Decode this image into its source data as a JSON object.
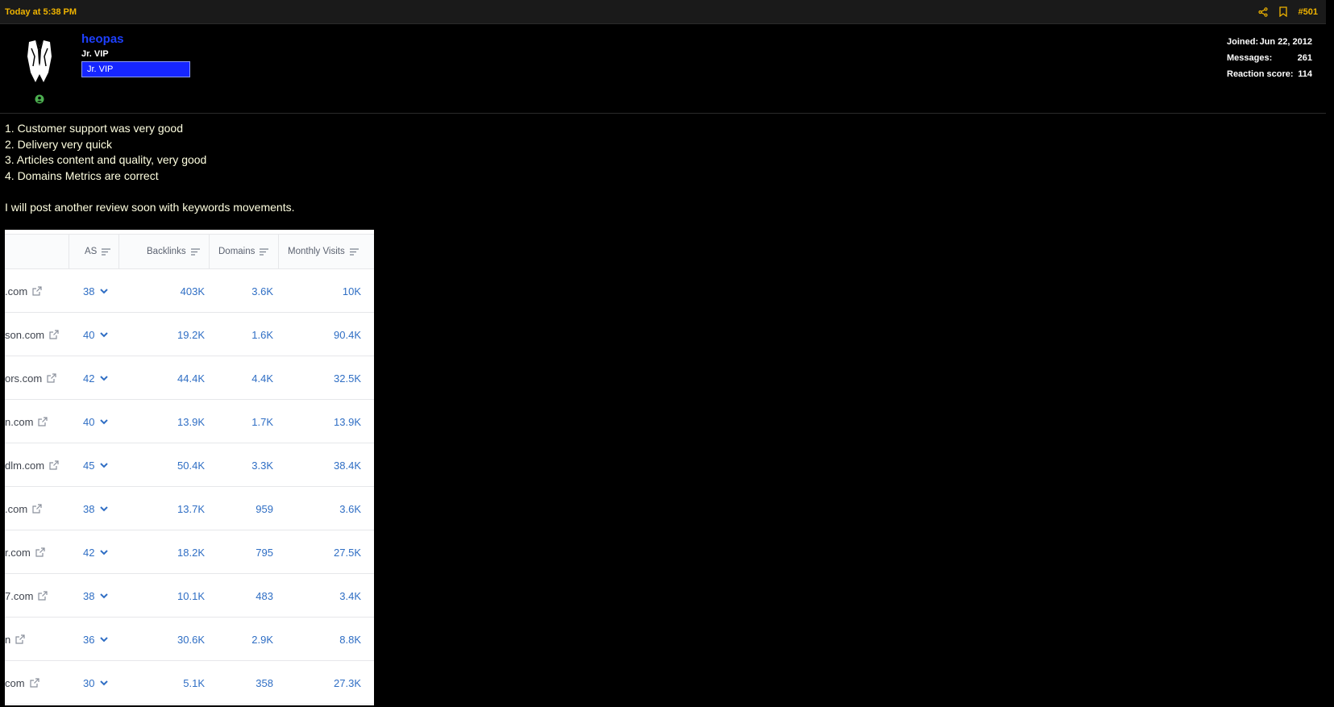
{
  "post": {
    "date": "Today at 5:38 PM",
    "number": "#501"
  },
  "user": {
    "name": "heopas",
    "title": "Jr. VIP",
    "banner": "Jr. VIP"
  },
  "stats": [
    {
      "label": "Joined:",
      "value": "Jun 22, 2012"
    },
    {
      "label": "Messages:",
      "value": "261"
    },
    {
      "label": "Reaction score:",
      "value": "114"
    }
  ],
  "message": {
    "lines": [
      "1. Customer support was very good",
      "2. Delivery very quick",
      "3. Articles content and quality, very good",
      "4. Domains Metrics are correct"
    ],
    "closing": "I will post another review soon with keywords movements."
  },
  "table": {
    "headers": [
      "AS",
      "Backlinks",
      "Domains",
      "Monthly Visits"
    ],
    "rows": [
      {
        "domain": ".com",
        "as": "38",
        "backlinks": "403K",
        "domains": "3.6K",
        "visits": "10K"
      },
      {
        "domain": "son.com",
        "as": "40",
        "backlinks": "19.2K",
        "domains": "1.6K",
        "visits": "90.4K"
      },
      {
        "domain": "ors.com",
        "as": "42",
        "backlinks": "44.4K",
        "domains": "4.4K",
        "visits": "32.5K"
      },
      {
        "domain": "n.com",
        "as": "40",
        "backlinks": "13.9K",
        "domains": "1.7K",
        "visits": "13.9K"
      },
      {
        "domain": "dlm.com",
        "as": "45",
        "backlinks": "50.4K",
        "domains": "3.3K",
        "visits": "38.4K"
      },
      {
        "domain": ".com",
        "as": "38",
        "backlinks": "13.7K",
        "domains": "959",
        "visits": "3.6K"
      },
      {
        "domain": "r.com",
        "as": "42",
        "backlinks": "18.2K",
        "domains": "795",
        "visits": "27.5K"
      },
      {
        "domain": "7.com",
        "as": "38",
        "backlinks": "10.1K",
        "domains": "483",
        "visits": "3.4K"
      },
      {
        "domain": "n",
        "as": "36",
        "backlinks": "30.6K",
        "domains": "2.9K",
        "visits": "8.8K"
      },
      {
        "domain": "com",
        "as": "30",
        "backlinks": "5.1K",
        "domains": "358",
        "visits": "27.3K"
      }
    ]
  },
  "icons": {
    "share": "share-icon",
    "bookmark": "bookmark-icon",
    "online": "online-status-icon",
    "external": "external-link-icon",
    "sort": "sort-icon",
    "chevron": "chevron-down-icon"
  },
  "colors": {
    "accent": "#f0b400",
    "username": "#1e40ff",
    "banner": "#1626ff",
    "message_text": "#ffffe0",
    "table_link": "#2f6ec4"
  }
}
